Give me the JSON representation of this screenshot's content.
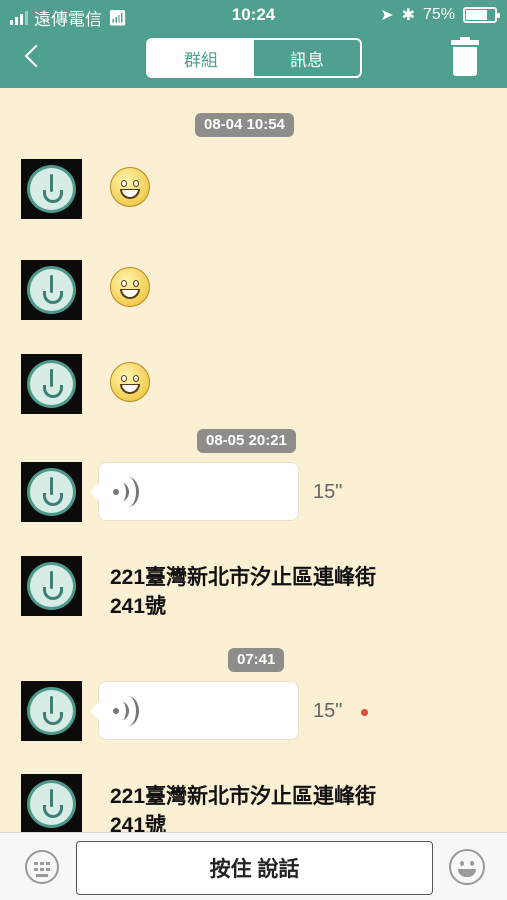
{
  "status_bar": {
    "carrier": "遠傳電信",
    "time": "10:24",
    "battery": "75%",
    "battery_level": 0.75
  },
  "nav": {
    "tabs": [
      {
        "label": "群組",
        "active": true
      },
      {
        "label": "訊息",
        "active": false
      }
    ],
    "icons": {
      "back": "chevron-left-icon",
      "delete": "trash-icon"
    }
  },
  "chat": {
    "timestamps": [
      "08-04 10:54",
      "08-05 20:21",
      "07:41"
    ],
    "messages": [
      {
        "type": "emoji",
        "content": "smiley"
      },
      {
        "type": "emoji",
        "content": "smiley"
      },
      {
        "type": "emoji",
        "content": "smiley"
      },
      {
        "type": "voice",
        "duration": "15\""
      },
      {
        "type": "text",
        "text": "221臺灣新北市汐止區連峰街241號"
      },
      {
        "type": "voice",
        "duration": "15\"",
        "unread": true
      },
      {
        "type": "text",
        "text": "221臺灣新北市汐止區連峰街241號"
      }
    ]
  },
  "bottom": {
    "hold_to_talk": "按住 說話",
    "icons": {
      "left": "keyboard-icon",
      "right": "emoji-icon"
    }
  },
  "colors": {
    "header": "#4fa08e",
    "background": "#fbefd4",
    "timestamp": "#8f8d89",
    "unread": "#e14a3a"
  }
}
